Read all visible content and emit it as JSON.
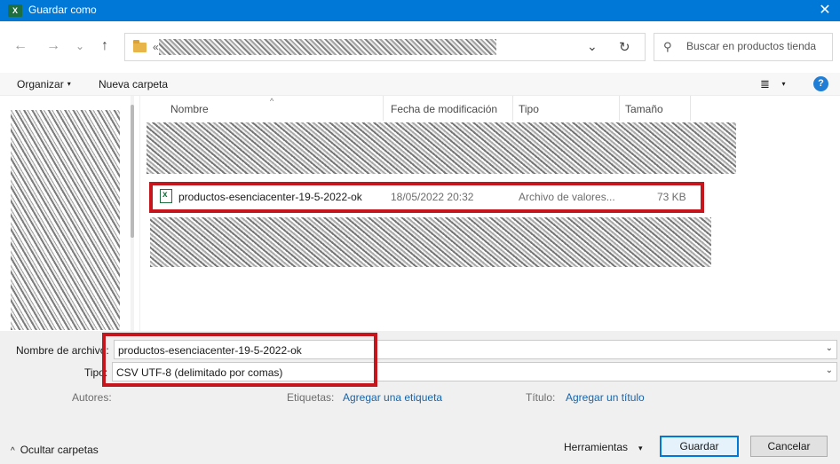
{
  "window": {
    "title": "Guardar como",
    "app_icon_letter": "X",
    "close_glyph": "✕"
  },
  "nav": {
    "back_glyph": "←",
    "forward_glyph": "→",
    "recent_glyph": "⌄",
    "up_glyph": "↑",
    "address_prefix": "«",
    "address_dropdown_glyph": "⌄",
    "refresh_glyph": "↻"
  },
  "search": {
    "placeholder": "Buscar en productos tienda",
    "icon": "search-icon",
    "glyph": "⚲"
  },
  "toolbar": {
    "organize_label": "Organizar",
    "new_folder_label": "Nueva carpeta",
    "view_glyph": "≣",
    "view_caret": "▾",
    "help_glyph": "?"
  },
  "columns": {
    "name": "Nombre",
    "modified": "Fecha de modificación",
    "type": "Tipo",
    "size": "Tamaño",
    "sort_glyph": "^"
  },
  "files": [
    {
      "name": "productos-esenciacenter-19-5-2022-ok",
      "modified": "18/05/2022 20:32",
      "type": "Archivo de valores...",
      "size": "73 KB",
      "highlighted": true
    }
  ],
  "form": {
    "filename_label": "Nombre de archivo:",
    "filename_value": "productos-esenciacenter-19-5-2022-ok",
    "type_label": "Tipo:",
    "type_value": "CSV UTF-8 (delimitado por comas)",
    "authors_label": "Autores:",
    "tags_label": "Etiquetas:",
    "tags_link": "Agregar una etiqueta",
    "title_label": "Título:",
    "title_link": "Agregar un título",
    "chevron_glyph": "⌄"
  },
  "footer": {
    "hide_folders_label": "Ocultar carpetas",
    "hide_folders_glyph": "^",
    "tools_label": "Herramientas",
    "tools_caret": "▾",
    "save_label": "Guardar",
    "cancel_label": "Cancelar"
  },
  "colors": {
    "titlebar": "#0078d7",
    "highlight": "#c4161c",
    "link": "#1864ab",
    "excel_green": "#1d6f42"
  }
}
